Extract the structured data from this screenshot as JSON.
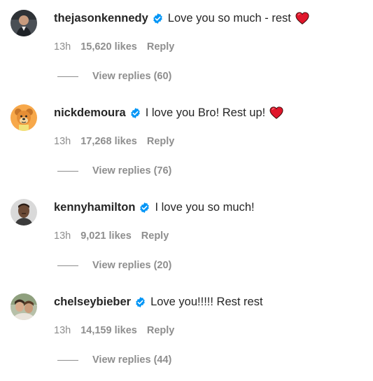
{
  "comments": [
    {
      "username": "thejasonkennedy",
      "text": "Love you so much - rest",
      "has_heart": true,
      "time": "13h",
      "likes": "15,620 likes",
      "reply_label": "Reply",
      "view_replies": "View replies (60)",
      "avatar_icon": "profile-photo"
    },
    {
      "username": "nickdemoura",
      "text": "I love you Bro! Rest up!",
      "has_heart": true,
      "time": "13h",
      "likes": "17,268 likes",
      "reply_label": "Reply",
      "view_replies": "View replies (76)",
      "avatar_icon": "cartoon-bear-avatar"
    },
    {
      "username": "kennyhamilton",
      "text": "I love you so much!",
      "has_heart": false,
      "time": "13h",
      "likes": "9,021 likes",
      "reply_label": "Reply",
      "view_replies": "View replies (20)",
      "avatar_icon": "profile-photo"
    },
    {
      "username": "chelseybieber",
      "text": "Love you!!!!! Rest rest",
      "has_heart": false,
      "time": "13h",
      "likes": "14,159 likes",
      "reply_label": "Reply",
      "view_replies": "View replies (44)",
      "avatar_icon": "profile-photo"
    }
  ],
  "colors": {
    "text": "#262626",
    "muted": "#8e8e8e",
    "verified": "#0095f6",
    "heart": "#e0162b"
  }
}
